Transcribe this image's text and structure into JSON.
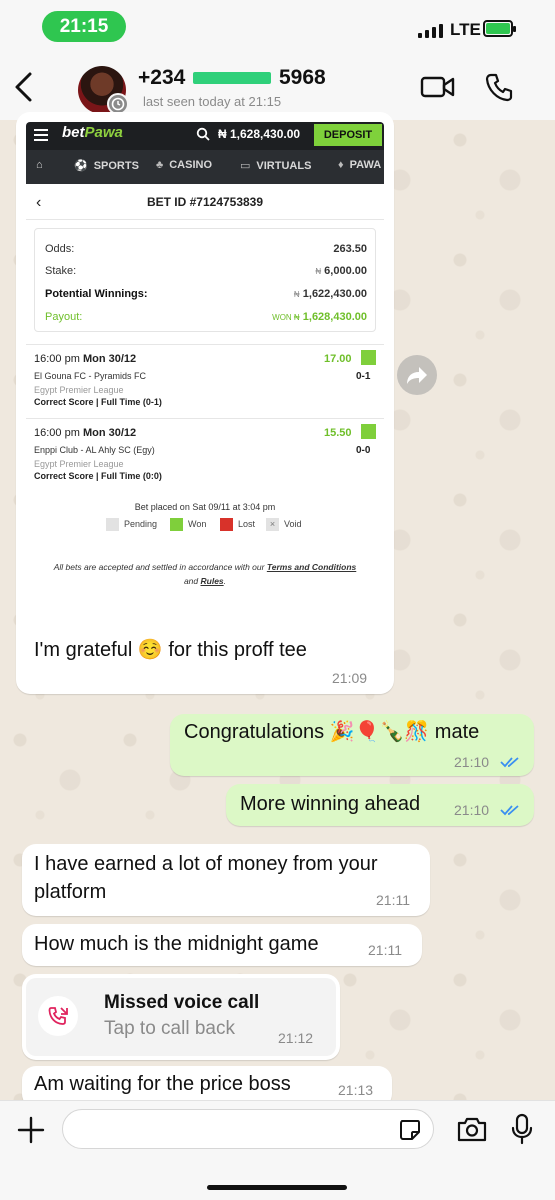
{
  "status_bar": {
    "time": "21:15",
    "network": "LTE"
  },
  "header": {
    "back_icon": "chevron-left-icon",
    "contact_prefix": "+234",
    "contact_suffix": "5968",
    "last_seen": "last seen today at 21:15",
    "video_icon": "video-camera-icon",
    "call_icon": "phone-icon"
  },
  "bet_screenshot": {
    "brand_prefix": "bet",
    "brand_suffix": "Pawa",
    "balance": "₦ 1,628,430.00",
    "deposit_label": "DEPOSIT",
    "nav": [
      "SPORTS",
      "CASINO",
      "VIRTUALS",
      "PAWA"
    ],
    "bet_id": "BET ID #7124753839",
    "odds_label": "Odds:",
    "odds_value": "263.50",
    "stake_label": "Stake:",
    "stake_currency": "₦",
    "stake_value": "6,000.00",
    "potential_label": "Potential Winnings:",
    "potential_currency": "₦",
    "potential_value": "1,622,430.00",
    "payout_label": "Payout:",
    "payout_prefix": "WON ₦",
    "payout_value": "1,628,430.00",
    "selections": [
      {
        "time": "16:00 pm",
        "date": "Mon 30/12",
        "odds": "17.00",
        "teams": "El Gouna FC - Pyramids FC",
        "score": "0-1",
        "league": "Egypt Premier League",
        "market": "Correct Score | Full Time (0-1)"
      },
      {
        "time": "16:00 pm",
        "date": "Mon 30/12",
        "odds": "15.50",
        "teams": "Enppi Club - AL Ahly SC (Egy)",
        "score": "0-0",
        "league": "Egypt Premier League",
        "market": "Correct Score | Full Time (0:0)"
      }
    ],
    "placed": "Bet placed on Sat 09/11 at 3:04 pm",
    "legend": [
      "Pending",
      "Won",
      "Lost",
      "Void"
    ],
    "terms_pre": "All bets are accepted and settled in accordance with our ",
    "terms_link": "Terms and Conditions",
    "terms_mid": " and ",
    "rules_link": "Rules",
    "terms_end": "."
  },
  "messages": [
    {
      "direction": "in",
      "text": "I'm grateful ☺️ for this proff tee",
      "time": "21:09"
    },
    {
      "direction": "out",
      "text": "Congratulations 🎉🎈🍾🎊 mate",
      "time": "21:10"
    },
    {
      "direction": "out",
      "text": "More winning ahead",
      "time": "21:10"
    },
    {
      "direction": "in",
      "text": "I have earned a lot of money from your platform",
      "time": "21:11"
    },
    {
      "direction": "in",
      "text": "How much is the midnight game",
      "time": "21:11"
    },
    {
      "direction": "in",
      "text": "Am waiting for the price boss",
      "time": "21:13"
    }
  ],
  "missed_call": {
    "title": "Missed voice call",
    "subtitle": "Tap to call back",
    "time": "21:12"
  },
  "input_bar": {
    "placeholder": ""
  },
  "colors": {
    "accent_green": "#2fc650",
    "outgoing_bubble": "#dcf8c6",
    "tick_blue": "#34b7f1",
    "missed_red": "#e0245e"
  }
}
